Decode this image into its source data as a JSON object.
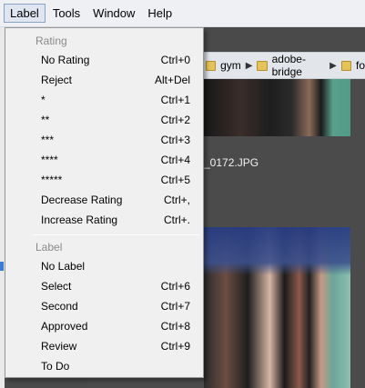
{
  "menubar": {
    "items": [
      "Label",
      "Tools",
      "Window",
      "Help"
    ],
    "active_index": 0
  },
  "path": {
    "segments": [
      "gym",
      "adobe-bridge",
      "fo"
    ]
  },
  "content": {
    "filename": "_0172.JPG"
  },
  "label_menu": {
    "rating_header": "Rating",
    "rating_items": [
      {
        "label": "No Rating",
        "shortcut": "Ctrl+0"
      },
      {
        "label": "Reject",
        "shortcut": "Alt+Del"
      },
      {
        "label": "*",
        "shortcut": "Ctrl+1"
      },
      {
        "label": "**",
        "shortcut": "Ctrl+2"
      },
      {
        "label": "***",
        "shortcut": "Ctrl+3"
      },
      {
        "label": "****",
        "shortcut": "Ctrl+4"
      },
      {
        "label": "*****",
        "shortcut": "Ctrl+5"
      },
      {
        "label": "Decrease Rating",
        "shortcut": "Ctrl+,"
      },
      {
        "label": "Increase Rating",
        "shortcut": "Ctrl+."
      }
    ],
    "label_header": "Label",
    "label_items": [
      {
        "label": "No Label",
        "shortcut": ""
      },
      {
        "label": "Select",
        "shortcut": "Ctrl+6"
      },
      {
        "label": "Second",
        "shortcut": "Ctrl+7"
      },
      {
        "label": "Approved",
        "shortcut": "Ctrl+8"
      },
      {
        "label": "Review",
        "shortcut": "Ctrl+9"
      },
      {
        "label": "To Do",
        "shortcut": ""
      }
    ]
  },
  "colors": {
    "menu_bg": "#f0f0f0",
    "header_text": "#8a8a8a",
    "active_menubar_border": "#8aa2c4",
    "folder_icon": "#e6c35a"
  }
}
